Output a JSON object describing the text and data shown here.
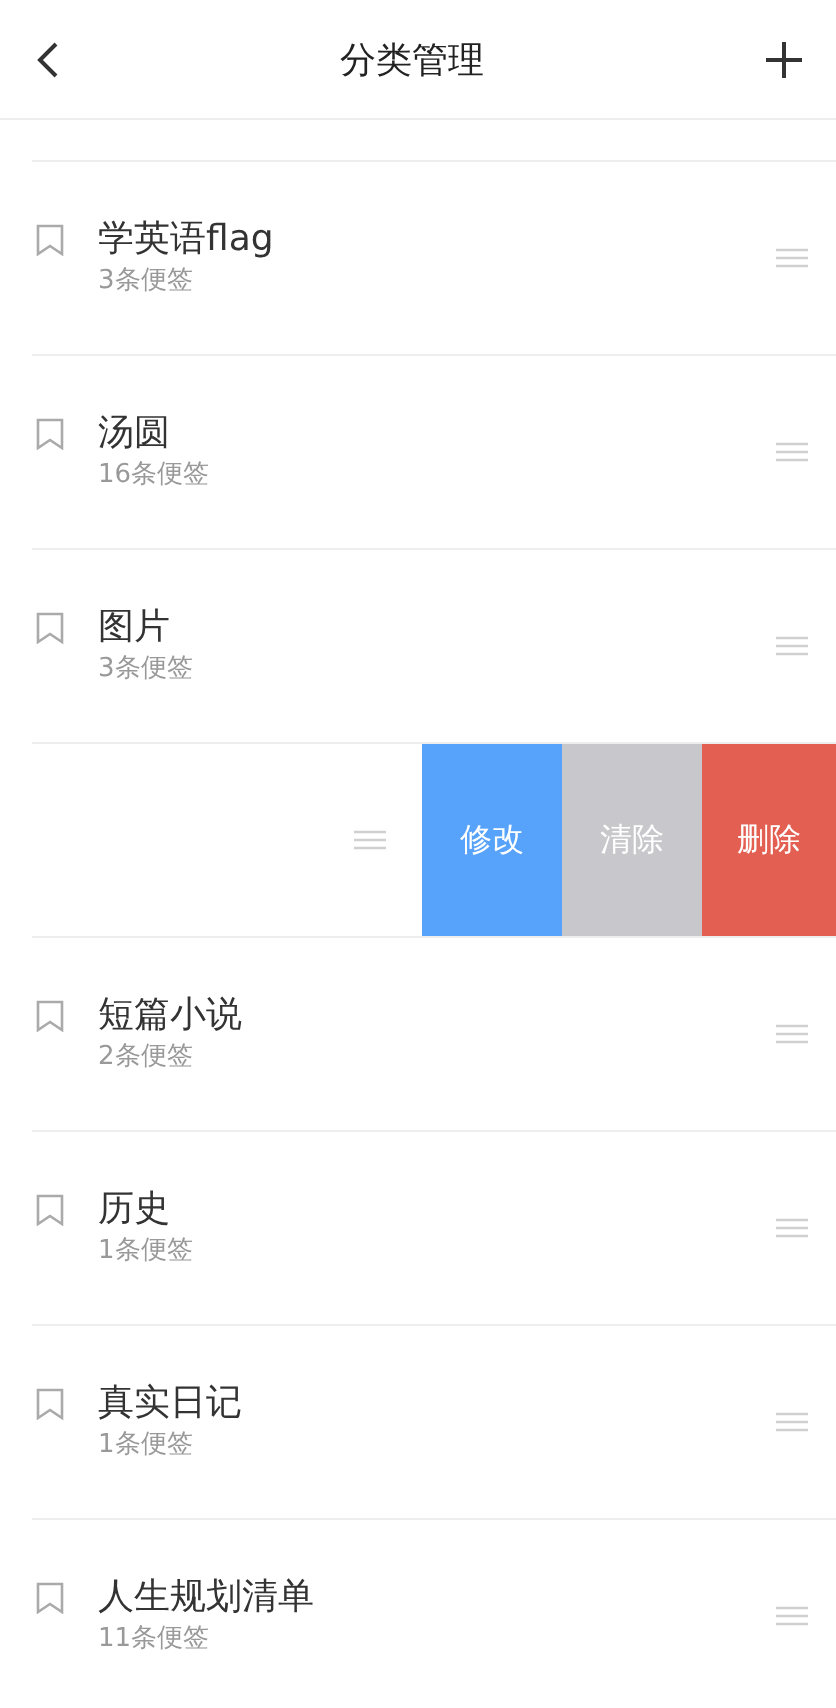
{
  "header": {
    "title": "分类管理"
  },
  "rows": [
    {
      "kind": "category",
      "title": "学英语flag",
      "count": "3条便签"
    },
    {
      "kind": "category",
      "title": "汤圆",
      "count": "16条便签"
    },
    {
      "kind": "category",
      "title": "图片",
      "count": "3条便签"
    },
    {
      "kind": "swiped",
      "actions": [
        {
          "label": "修改",
          "color": "#57a3fb"
        },
        {
          "label": "清除",
          "color": "#c8c8cc"
        },
        {
          "label": "删除",
          "color": "#e35f51"
        }
      ]
    },
    {
      "kind": "category",
      "title": "短篇小说",
      "count": "2条便签"
    },
    {
      "kind": "category",
      "title": "历史",
      "count": "1条便签"
    },
    {
      "kind": "category",
      "title": "真实日记",
      "count": "1条便签"
    },
    {
      "kind": "category",
      "title": "人生规划清单",
      "count": "11条便签"
    }
  ]
}
